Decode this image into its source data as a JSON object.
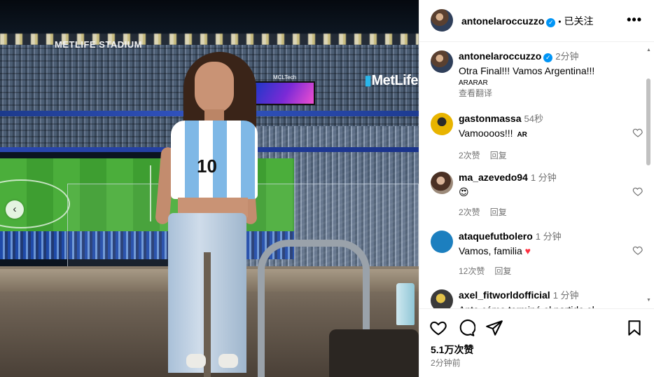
{
  "photo": {
    "stadium_sign": "METLIFE STADIUM",
    "scoreboard_text": "MCLTech",
    "metlife_logo": "MetLife",
    "shirt_number": "10",
    "nav_prev_icon": "chevron-left-icon"
  },
  "header": {
    "username": "antonelaroccuzzo",
    "separator": "•",
    "follow_status": "已关注",
    "more_icon": "more-horizontal-icon"
  },
  "caption": {
    "username": "antonelaroccuzzo",
    "time": "2分钟",
    "text": "Otra Final!!! Vamos Argentina!!!",
    "flags": "ARARAR",
    "translate": "查看翻译"
  },
  "comments": [
    {
      "username": "gastonmassa",
      "time": "54秒",
      "text": "Vamoooos!!!",
      "flag": "AR",
      "likes": "2次赞",
      "reply": "回复"
    },
    {
      "username": "ma_azevedo94",
      "time": "1 分钟",
      "text": "😍",
      "likes": "2次赞",
      "reply": "回复"
    },
    {
      "username": "ataquefutbolero",
      "time": "1 分钟",
      "text": "Vamos, familia",
      "heart": "♥",
      "likes": "12次赞",
      "reply": "回复"
    },
    {
      "username": "axel_fitworldofficial",
      "time": "1 分钟",
      "text": "Anto cómo terminó el partido el"
    }
  ],
  "actions": {
    "like_icon": "heart-icon",
    "comment_icon": "comment-icon",
    "share_icon": "share-icon",
    "save_icon": "bookmark-icon",
    "likes": "5.1万次赞",
    "posted": "2分钟前"
  },
  "colors": {
    "verified": "#0095f6",
    "secondary_text": "#737373",
    "heart_red": "#ff3040"
  }
}
